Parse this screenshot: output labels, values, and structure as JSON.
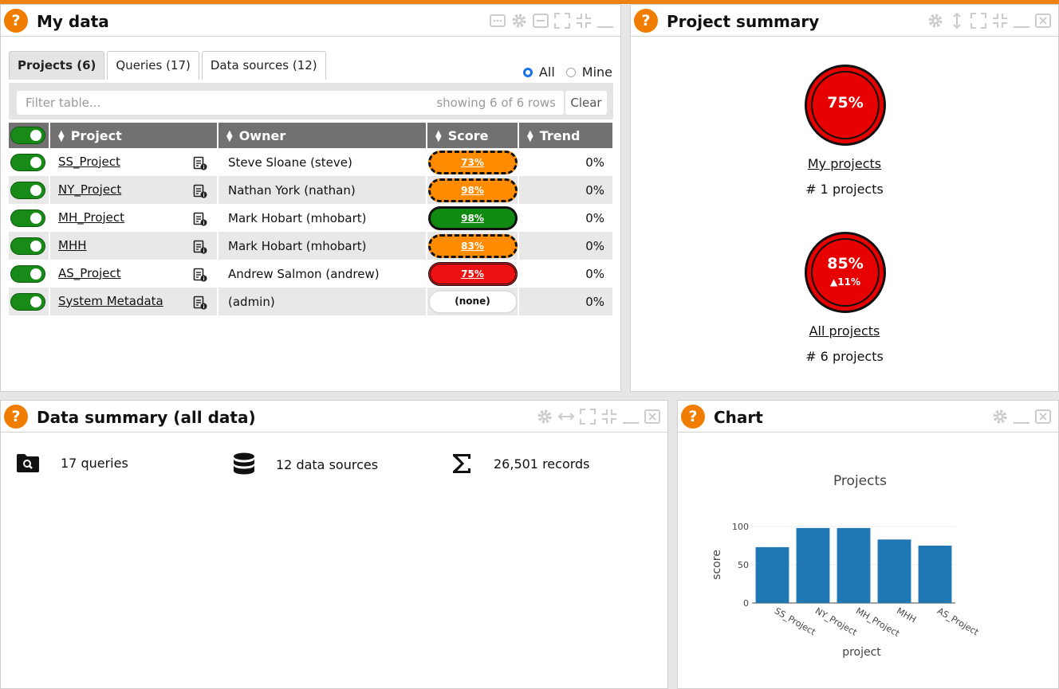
{
  "panels": {
    "my_data": {
      "title": "My data"
    },
    "project_summary": {
      "title": "Project summary"
    },
    "data_summary": {
      "title": "Data summary (all data)"
    },
    "chart": {
      "title": "Chart"
    }
  },
  "help_label": "?",
  "tabs": [
    {
      "label": "Projects (6)",
      "active": true
    },
    {
      "label": "Queries (17)",
      "active": false
    },
    {
      "label": "Data sources (12)",
      "active": false
    }
  ],
  "scope": {
    "all": "All",
    "mine": "Mine",
    "selected": "All"
  },
  "filter": {
    "placeholder": "Filter table...",
    "count": "showing 6 of 6 rows",
    "clear": "Clear"
  },
  "table": {
    "headers": {
      "project": "Project",
      "owner": "Owner",
      "score": "Score",
      "trend": "Trend"
    },
    "rows": [
      {
        "project": "SS_Project",
        "owner": "Steve Sloane (steve)",
        "score": "73%",
        "status": "warning",
        "trend": "0%"
      },
      {
        "project": "NY_Project",
        "owner": "Nathan York (nathan)",
        "score": "98%",
        "status": "warning",
        "trend": "0%"
      },
      {
        "project": "MH_Project",
        "owner": "Mark Hobart (mhobart)",
        "score": "98%",
        "status": "good",
        "trend": "0%"
      },
      {
        "project": "MHH",
        "owner": "Mark Hobart (mhobart)",
        "score": "83%",
        "status": "warning",
        "trend": "0%"
      },
      {
        "project": "AS_Project",
        "owner": "Andrew Salmon (andrew)",
        "score": "75%",
        "status": "bad",
        "trend": "0%"
      },
      {
        "project": "System Metadata",
        "owner": "(admin)",
        "score": "(none)",
        "status": "none",
        "trend": "0%"
      }
    ]
  },
  "summary": {
    "my": {
      "value": "75%",
      "link": "My projects",
      "count": "# 1 projects"
    },
    "all": {
      "value": "85%",
      "delta": "▲11%",
      "link": "All projects",
      "count": "# 6 projects"
    }
  },
  "data_summary": {
    "queries": "17 queries",
    "sources": "12 data sources",
    "records": "26,501 records"
  },
  "colors": {
    "accent": "#f07d00",
    "good": "#118a11",
    "warning": "#ff8c00",
    "bad": "#ee1111",
    "bar": "#1f77b4"
  },
  "chart_data": {
    "type": "bar",
    "title": "Projects",
    "xlabel": "project",
    "ylabel": "score",
    "categories": [
      "SS_Project",
      "NY_Project",
      "MH_Project",
      "MHH",
      "AS_Project"
    ],
    "values": [
      73,
      98,
      98,
      83,
      75
    ],
    "ylim": [
      0,
      100
    ],
    "yticks": [
      0,
      50,
      100
    ],
    "grid": true
  }
}
